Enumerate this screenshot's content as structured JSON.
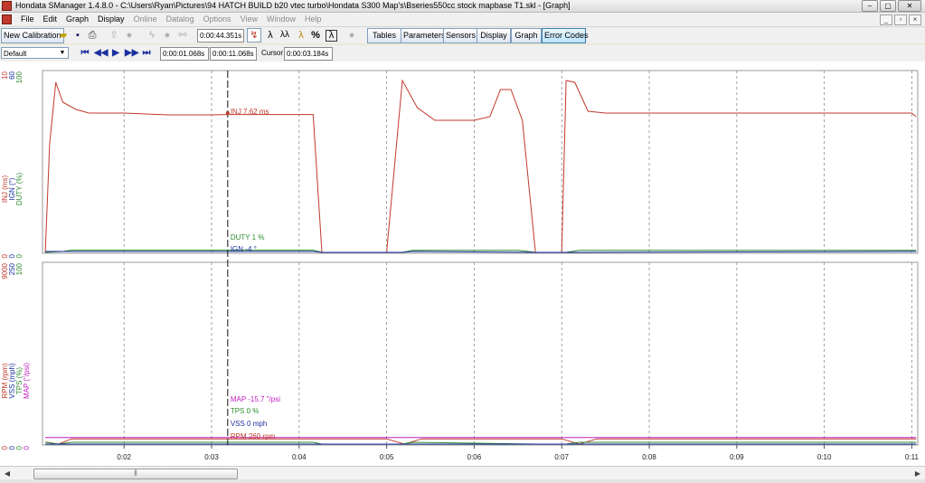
{
  "window": {
    "title": "Hondata SManager 1.4.8.0 - C:\\Users\\Ryan\\Pictures\\94 HATCH BUILD b20 vtec turbo\\Hondata S300 Map's\\Bseries550cc stock mapbase T1.skl - [Graph]",
    "min_glyph": "–",
    "max_glyph": "▢",
    "close_glyph": "✕"
  },
  "menubar": {
    "items": [
      "File",
      "Edit",
      "Graph",
      "Display",
      "Online",
      "Datalog",
      "Options",
      "View",
      "Window",
      "Help"
    ],
    "mdi": [
      "_",
      "▫",
      "×"
    ]
  },
  "toolbar": {
    "new_calibration": "New Calibration",
    "time_total": "0:00:44.351s",
    "lambda_glyphs": [
      "λ",
      "λλ",
      "λ",
      "%",
      "λ"
    ],
    "tabs": [
      "Tables",
      "Parameters",
      "Sensors",
      "Display",
      "Graph",
      "Error Codes"
    ],
    "active_tab": "Error Codes"
  },
  "toolbar2": {
    "preset": "Default",
    "time_a": "0:00:01.068s",
    "time_b": "0:00:11.068s",
    "cursor_label": "Cursor",
    "cursor_time": "0:00:03.184s"
  },
  "graph": {
    "top_axis": {
      "max_labels": [
        "10",
        "60",
        "100"
      ],
      "min_labels": [
        "0",
        "0",
        "0"
      ],
      "axis_names": [
        "INJ (ms)",
        "IGN (°)",
        "DUTY (%)"
      ],
      "colors": [
        "#c0392b",
        "#1a2fa0",
        "#2e8b2e"
      ]
    },
    "bottom_axis": {
      "max_labels": [
        "9000",
        "250",
        "100"
      ],
      "min_labels": [
        "0",
        "0",
        "0",
        "0"
      ],
      "axis_names": [
        "RPM (rpm)",
        "VSS (mph)",
        "TPS (%)",
        "MAP (\"/psi)"
      ],
      "colors": [
        "#c0392b",
        "#1a2fa0",
        "#2e8b2e",
        "#c020c0"
      ]
    },
    "cursor_readouts": {
      "inj": "INJ 7.62 ms",
      "duty": "DUTY 1 %",
      "ign": "IGN -4 °",
      "map": "MAP -15.7 \"/psi",
      "tps": "TPS 0 %",
      "vss": "VSS 0 mph",
      "rpm": "RPM 260 rpm"
    },
    "x_ticks": [
      "0:02",
      "0:03",
      "0:04",
      "0:05",
      "0:06",
      "0:07",
      "0:08",
      "0:09",
      "0:10",
      "0:11"
    ],
    "cursor_time_s": 3.184
  },
  "chart_data": {
    "type": "line",
    "x_unit": "time (s)",
    "xlim": [
      1.068,
      11.068
    ],
    "panels": [
      {
        "series": [
          {
            "name": "INJ (ms)",
            "color": "#c0392b",
            "ylim": [
              0,
              10
            ],
            "x": [
              1.1,
              1.15,
              1.22,
              1.3,
              1.45,
              1.6,
              2.0,
              2.5,
              3.0,
              3.184,
              3.5,
              4.0,
              4.16,
              4.26,
              4.4,
              4.8,
              5.0,
              5.18,
              5.35,
              5.55,
              5.8,
              6.0,
              6.18,
              6.3,
              6.42,
              6.55,
              6.7,
              6.9,
              7.0,
              7.05,
              7.15,
              7.3,
              7.5,
              8.0,
              8.5,
              9.0,
              9.5,
              10.0,
              10.5,
              11.0,
              11.05
            ],
            "y": [
              0,
              6.0,
              9.4,
              8.3,
              7.9,
              7.7,
              7.7,
              7.6,
              7.6,
              7.62,
              7.62,
              7.62,
              7.62,
              0,
              0,
              0,
              0,
              9.5,
              8.0,
              7.3,
              7.3,
              7.3,
              7.5,
              9.0,
              9.0,
              7.3,
              0,
              0,
              0,
              9.5,
              9.4,
              7.8,
              7.7,
              7.7,
              7.7,
              7.7,
              7.7,
              7.7,
              7.7,
              7.7,
              7.5
            ]
          },
          {
            "name": "DUTY (%)",
            "color": "#2e8b2e",
            "ylim": [
              0,
              100
            ],
            "x": [
              1.1,
              1.3,
              1.4,
              4.16,
              4.26,
              5.18,
              5.3,
              6.5,
              6.7,
              7.05,
              7.2,
              11.05
            ],
            "y": [
              0,
              0.5,
              1.2,
              1.2,
              0,
              0,
              1.1,
              1.1,
              0,
              0,
              1.1,
              1.1
            ]
          },
          {
            "name": "IGN (°)",
            "color": "#1a2fa0",
            "ylim": [
              0,
              60
            ],
            "x": [
              1.1,
              4.16,
              4.26,
              5.18,
              5.3,
              6.7,
              7.05,
              11.05
            ],
            "y": [
              0.3,
              0.3,
              0,
              0,
              0.3,
              0,
              0,
              0.3
            ]
          }
        ]
      },
      {
        "series": [
          {
            "name": "RPM (rpm)",
            "color": "#c0392b",
            "ylim": [
              0,
              9000
            ],
            "x": [
              1.1,
              1.25,
              1.4,
              2.0,
              3.0,
              4.0,
              5.0,
              5.2,
              5.4,
              6.0,
              7.0,
              7.2,
              7.4,
              8.0,
              9.0,
              10.0,
              11.05
            ],
            "y": [
              100,
              0,
              260,
              260,
              260,
              260,
              260,
              0,
              260,
              260,
              260,
              0,
              260,
              260,
              260,
              260,
              260
            ]
          },
          {
            "name": "TPS (%)",
            "color": "#2e8b2e",
            "ylim": [
              0,
              100
            ],
            "x": [
              1.1,
              1.25,
              1.4,
              4.16,
              4.26,
              5.18,
              5.3,
              6.7,
              7.05,
              7.2,
              11.05
            ],
            "y": [
              1.0,
              0,
              1.0,
              1.0,
              0,
              0,
              1.0,
              0,
              0,
              1.0,
              1.0
            ]
          },
          {
            "name": "VSS (mph)",
            "color": "#1a2fa0",
            "ylim": [
              0,
              250
            ],
            "x": [
              1.1,
              11.05
            ],
            "y": [
              0,
              0
            ]
          },
          {
            "name": "MAP (\"/psi)",
            "color": "#c020c0",
            "ylim": [
              -20,
              100
            ],
            "x": [
              1.1,
              11.05
            ],
            "y": [
              -15.7,
              -15.7
            ]
          }
        ]
      }
    ]
  }
}
